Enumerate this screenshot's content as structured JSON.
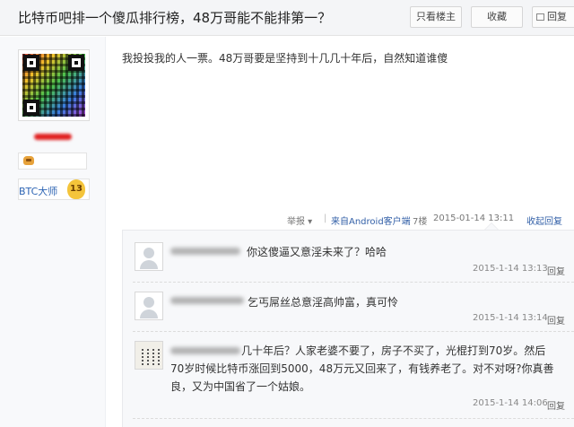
{
  "header": {
    "title": "比特币吧排一个傻瓜排行榜，48万哥能不能排第一？",
    "btn_louzhu": "只看楼主",
    "btn_fav": "收藏",
    "btn_reply": "回复"
  },
  "user": {
    "level_name": "BTC大师",
    "level_num": "13"
  },
  "post": {
    "text": "我投投我的人一票。48万哥要是坚持到十几几十年后，自然知道谁傻",
    "report": "举报 ▾",
    "separator": "|",
    "client": "来自Android客户端",
    "floor": "7楼",
    "date": "2015-01-14 13:11",
    "reply_toggle": "收起回复"
  },
  "comments": [
    {
      "text": "你这傻逼又意淫未来了？哈哈",
      "time": "2015-1-14 13:13",
      "reply": "回复"
    },
    {
      "text": "乞丐屌丝总意淫高帅富，真可怜",
      "time": "2015-1-14 13:14",
      "reply": "回复"
    },
    {
      "line1": "几十年后？人家老婆不要了，房子不买了，光棍打到70岁。然后",
      "line2": "70岁时候比特币涨回到5000，48万元又回来了，有钱养老了。对不对呀?你真善",
      "line3": "良，又为中国省了一个姑娘。",
      "time": "2015-1-14 14:06",
      "reply": "回复"
    }
  ]
}
